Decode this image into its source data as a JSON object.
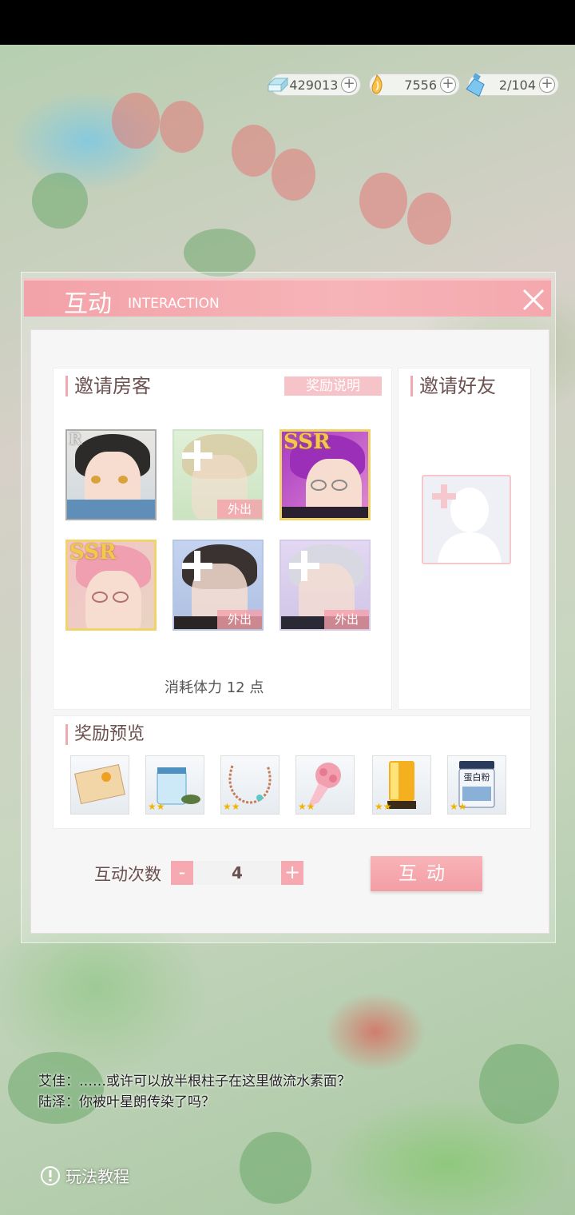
{
  "currencies": [
    {
      "icon": "diamond-icon",
      "value": "429013"
    },
    {
      "icon": "coin-icon",
      "value": "7556"
    },
    {
      "icon": "stamina-potion-icon",
      "value": "2/104"
    }
  ],
  "dialog": {
    "title_cn": "互动",
    "title_en": "INTERACTION"
  },
  "invite_guests": {
    "title": "邀请房客",
    "reward_info_label": "奖励说明",
    "cards": [
      {
        "rarity": "R",
        "out": false,
        "selectable": false
      },
      {
        "rarity": "",
        "out": true,
        "out_label": "外出"
      },
      {
        "rarity": "SSR",
        "out": false
      },
      {
        "rarity": "SSR",
        "out": false
      },
      {
        "rarity": "",
        "out": true,
        "out_label": "外出"
      },
      {
        "rarity": "",
        "out": true,
        "out_label": "外出"
      }
    ],
    "cost_text": "消耗体力 12 点"
  },
  "invite_friends": {
    "title": "邀请好友"
  },
  "reward_preview": {
    "title": "奖励预览",
    "items": [
      {
        "icon": "spring-card-icon"
      },
      {
        "icon": "vip-jar-icon"
      },
      {
        "icon": "necklace-icon"
      },
      {
        "icon": "bouquet-icon"
      },
      {
        "icon": "lamp-icon"
      },
      {
        "icon": "protein-powder-icon",
        "label": "蛋白粉"
      }
    ]
  },
  "interact": {
    "count_label": "互动次数",
    "minus": "-",
    "plus": "+",
    "count": "4",
    "button_label": "互动"
  },
  "dialogue_lines": [
    "艾佳：……或许可以放半根柱子在这里做流水素面？",
    "陆泽：你被叶星朗传染了吗？"
  ],
  "tutorial_label": "玩法教程",
  "colors": {
    "accent_pink": "#f39ea5",
    "ssr_gold": "#f0d36a"
  }
}
